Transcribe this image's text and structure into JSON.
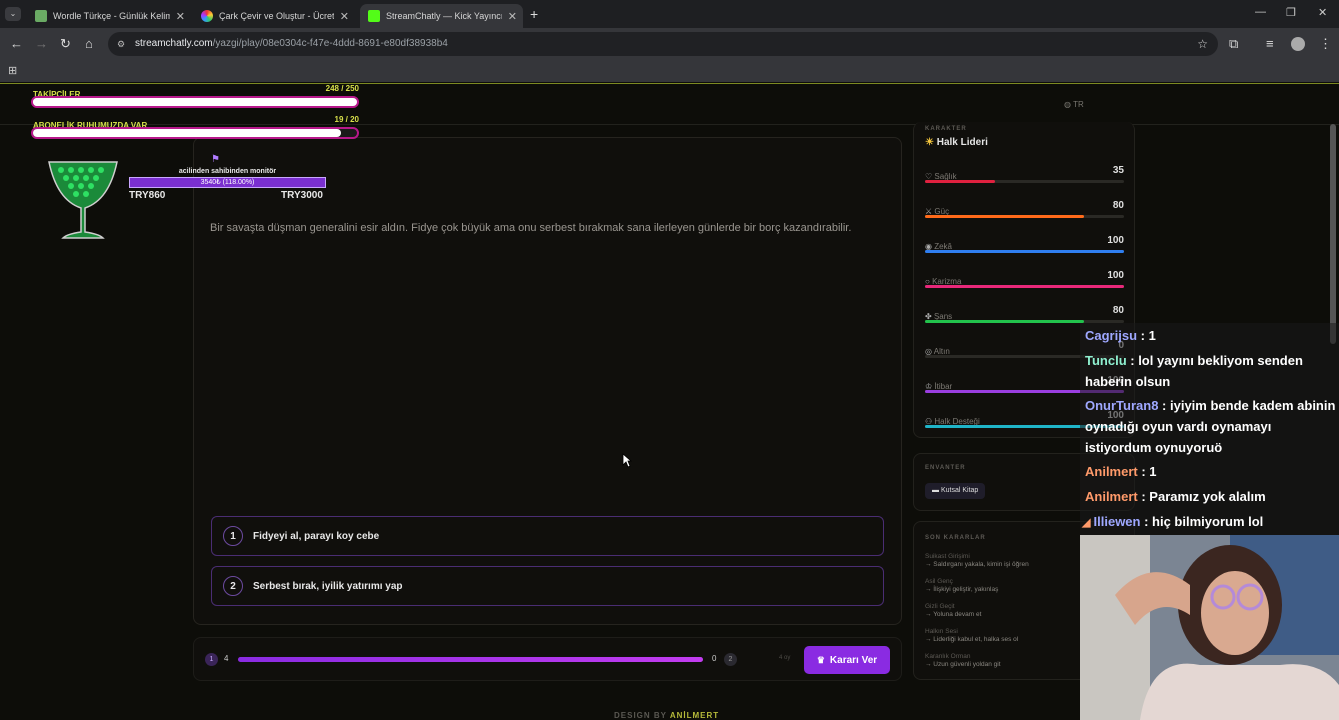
{
  "browser": {
    "tabs": [
      {
        "title": "Wordle Türkçe - Günlük Kelime",
        "icon": "wordle-icon"
      },
      {
        "title": "Çark Çevir ve Oluştur - Ücretsiz",
        "icon": "wheel-icon"
      },
      {
        "title": "StreamChatly — Kick Yayıncıları",
        "icon": "streamchatly-icon"
      }
    ],
    "url_host": "streamchatly.com",
    "url_path": "/yazgi/play/08e0304c-f47e-4ddd-8691-e80df38938b4"
  },
  "header": {
    "lang": "TR"
  },
  "overlay": {
    "followers_label": "TAKİPÇİLER",
    "followers_value": "248 / 250",
    "followers_progress": 0.992,
    "subs_label": "ABONELİK RUHUMUZDA VAR",
    "subs_value": "19 / 20",
    "subs_progress": 0.95,
    "monitor_title": "acilinden sahibinden monitör",
    "monitor_bar": "3540₺ (118.00%)",
    "monitor_bar_progress": 1.0,
    "price_left": "TRY860",
    "price_right": "TRY3000"
  },
  "game": {
    "scenario": "Bir savaşta düşman generalini esir aldın. Fidye çok büyük ama onu serbest bırakmak sana ilerleyen günlerde bir borç kazandırabilir.",
    "choices": [
      {
        "num": "1",
        "label": "Fidyeyi al, parayı koy cebe"
      },
      {
        "num": "2",
        "label": "Serbest bırak, iyilik yatırımı yap"
      }
    ],
    "vote_left_num": "1",
    "vote_left_count": "4",
    "vote_right_count": "0",
    "vote_right_num": "2",
    "vote_progress": 1.0,
    "vote_meta": "4 oy",
    "decide_button": "Kararı Ver",
    "footer": "DESIGN BY",
    "footer_author": "ANİLMERT"
  },
  "character": {
    "section_label": "KARAKTER",
    "name": "Halk Lideri",
    "stats": [
      {
        "label": "Sağlık",
        "value": "35",
        "pct": 0.35,
        "color": "#e0213f",
        "icon": "heart-icon"
      },
      {
        "label": "Güç",
        "value": "80",
        "pct": 0.8,
        "color": "#ff6a1a",
        "icon": "sword-icon"
      },
      {
        "label": "Zekâ",
        "value": "100",
        "pct": 1.0,
        "color": "#2f7ef0",
        "icon": "brain-icon"
      },
      {
        "label": "Karizma",
        "value": "100",
        "pct": 1.0,
        "color": "#e8287a",
        "icon": "chat-icon"
      },
      {
        "label": "Şans",
        "value": "80",
        "pct": 0.8,
        "color": "#22c24c",
        "icon": "clover-icon"
      },
      {
        "label": "Altın",
        "value": "0",
        "pct": 0.0,
        "color": "#e0b020",
        "icon": "coin-icon"
      },
      {
        "label": "İtibar",
        "value": "100",
        "pct": 1.0,
        "color": "#9a3ee0",
        "icon": "crown-icon"
      },
      {
        "label": "Halk Desteği",
        "value": "100",
        "pct": 1.0,
        "color": "#1fb4c8",
        "icon": "people-icon"
      }
    ]
  },
  "inventory": {
    "section_label": "ENVANTER",
    "items": [
      "Kutsal Kitap"
    ]
  },
  "recent": {
    "section_label": "SON KARARLAR",
    "items": [
      {
        "title": "Suikast Girişimi",
        "choice": "→ Saldırganı yakala, kimin işi öğren"
      },
      {
        "title": "Asil Genç",
        "choice": "→ İlişkiyi geliştir, yakınlaş"
      },
      {
        "title": "Gizli Geçit",
        "choice": "→ Yoluna devam et"
      },
      {
        "title": "Halkın Sesi",
        "choice": "→ Liderliği kabul et, halka ses ol"
      },
      {
        "title": "Karanlık Orman",
        "choice": "→ Uzun güvenli yoldan git"
      }
    ]
  },
  "chat": [
    {
      "user": "Cagrijsu",
      "color": "#9fa8ff",
      "text": " : 1"
    },
    {
      "user": "Tunclu",
      "color": "#8ff0d0",
      "text": " : lol yayını bekliyom senden haberin olsun"
    },
    {
      "user": "OnurTuran8",
      "color": "#9fa8ff",
      "text": " : iyiyim bende kadem abinin oynadığı oyun vardı oynamayı istiyordum oynuyoruö"
    },
    {
      "user": "Anilmert",
      "color": "#ff9a6a",
      "text": " : 1"
    },
    {
      "user": "Anilmert",
      "color": "#ff9a6a",
      "text": " : Paramız yok alalım"
    },
    {
      "user": "Illiewen",
      "color": "#9fa8ff",
      "text": " : hiç bilmiyorum lol"
    }
  ]
}
